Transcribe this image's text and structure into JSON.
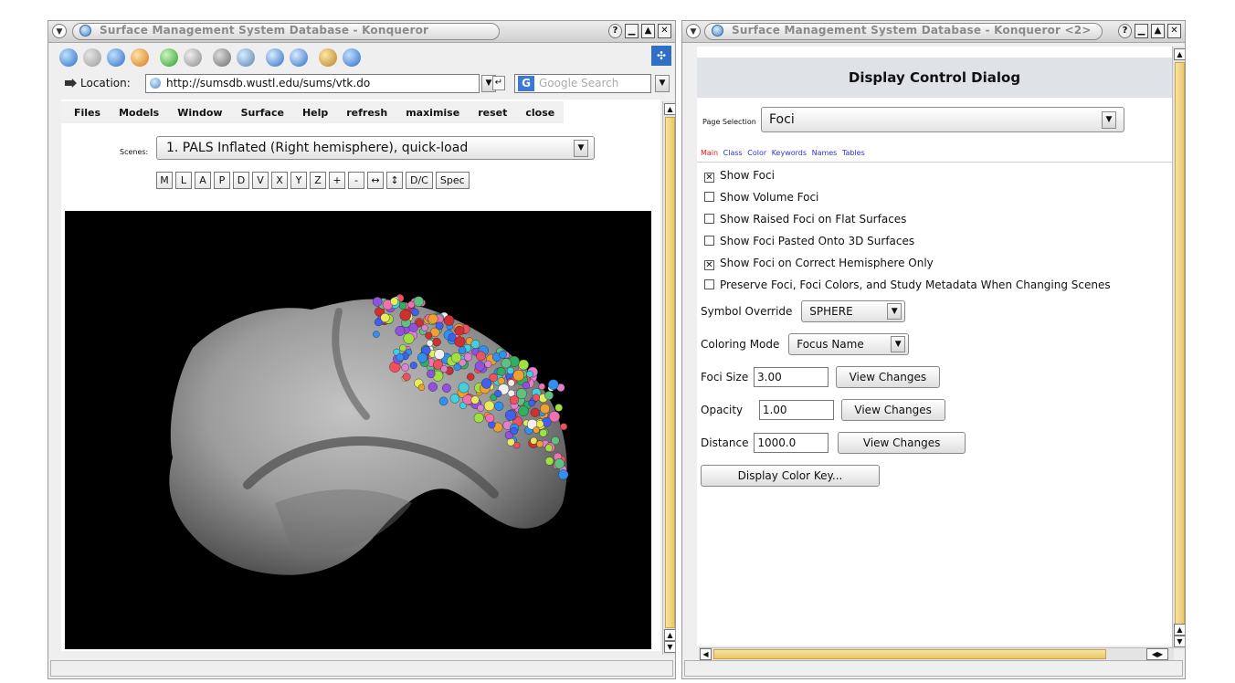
{
  "left_window": {
    "title": "Surface Management System Database - Konqueror",
    "location_label": "Location:",
    "url": "http://sumsdb.wustl.edu/sums/vtk.do",
    "search_placeholder": "Google Search",
    "menu": [
      "Files",
      "Models",
      "Window",
      "Surface",
      "Help",
      "refresh",
      "maximise",
      "reset",
      "close"
    ],
    "scenes_label": "Scenes:",
    "scene_selected": "1. PALS Inflated (Right hemisphere), quick-load",
    "view_buttons": [
      "M",
      "L",
      "A",
      "P",
      "D",
      "V",
      "X",
      "Y",
      "Z",
      "+",
      "-",
      "↔",
      "↕",
      "D/C",
      "Spec"
    ],
    "toolbar_icons": [
      "back-icon",
      "forward-icon",
      "up-icon",
      "home-icon",
      "reload-icon",
      "stop-icon",
      "print-icon",
      "find-icon",
      "zoom-in-icon",
      "zoom-out-icon",
      "security-icon",
      "download-icon"
    ],
    "viewport_description": "inflated-brain-surface-with-foci",
    "foci_colors": [
      "#e8ec5a",
      "#f05060",
      "#4060f0",
      "#30b060",
      "#e080d0",
      "#40d0e0",
      "#f0a030",
      "#9050e0",
      "#f0f0f0",
      "#d03030",
      "#60c080",
      "#f070b0",
      "#3090f0",
      "#a0e040"
    ]
  },
  "right_window": {
    "title": "Surface Management System Database - Konqueror <2>",
    "dialog_title": "Display Control Dialog",
    "page_selection_label": "Page Selection",
    "page_selected": "Foci",
    "tabs": [
      "Main",
      "Class",
      "Color",
      "Keywords",
      "Names",
      "Tables"
    ],
    "active_tab": "Main",
    "options": [
      {
        "label": "Show Foci",
        "checked": true
      },
      {
        "label": "Show Volume Foci",
        "checked": false
      },
      {
        "label": "Show Raised Foci on Flat Surfaces",
        "checked": false
      },
      {
        "label": "Show Foci Pasted Onto 3D Surfaces",
        "checked": false
      },
      {
        "label": "Show Foci on Correct Hemisphere Only",
        "checked": true
      },
      {
        "label": "Preserve Foci, Foci Colors, and Study Metadata When Changing Scenes",
        "checked": false
      }
    ],
    "symbol_override_label": "Symbol Override",
    "symbol_override_value": "SPHERE",
    "coloring_mode_label": "Coloring Mode",
    "coloring_mode_value": "Focus Name",
    "foci_size_label": "Foci Size",
    "foci_size_value": "3.00",
    "opacity_label": "Opacity",
    "opacity_value": "1.00",
    "distance_label": "Distance",
    "distance_value": "1000.0",
    "view_changes_label": "View Changes",
    "display_color_key_label": "Display Color Key..."
  },
  "colors": {
    "scroll_thumb": "#e9c86a",
    "dialog_header_bg": "#dfe3e8",
    "tab_active": "#e01616",
    "tab_link": "#2a35c8",
    "title_text": "#8a8a8a",
    "brain_surface": "#9c9c9c"
  }
}
